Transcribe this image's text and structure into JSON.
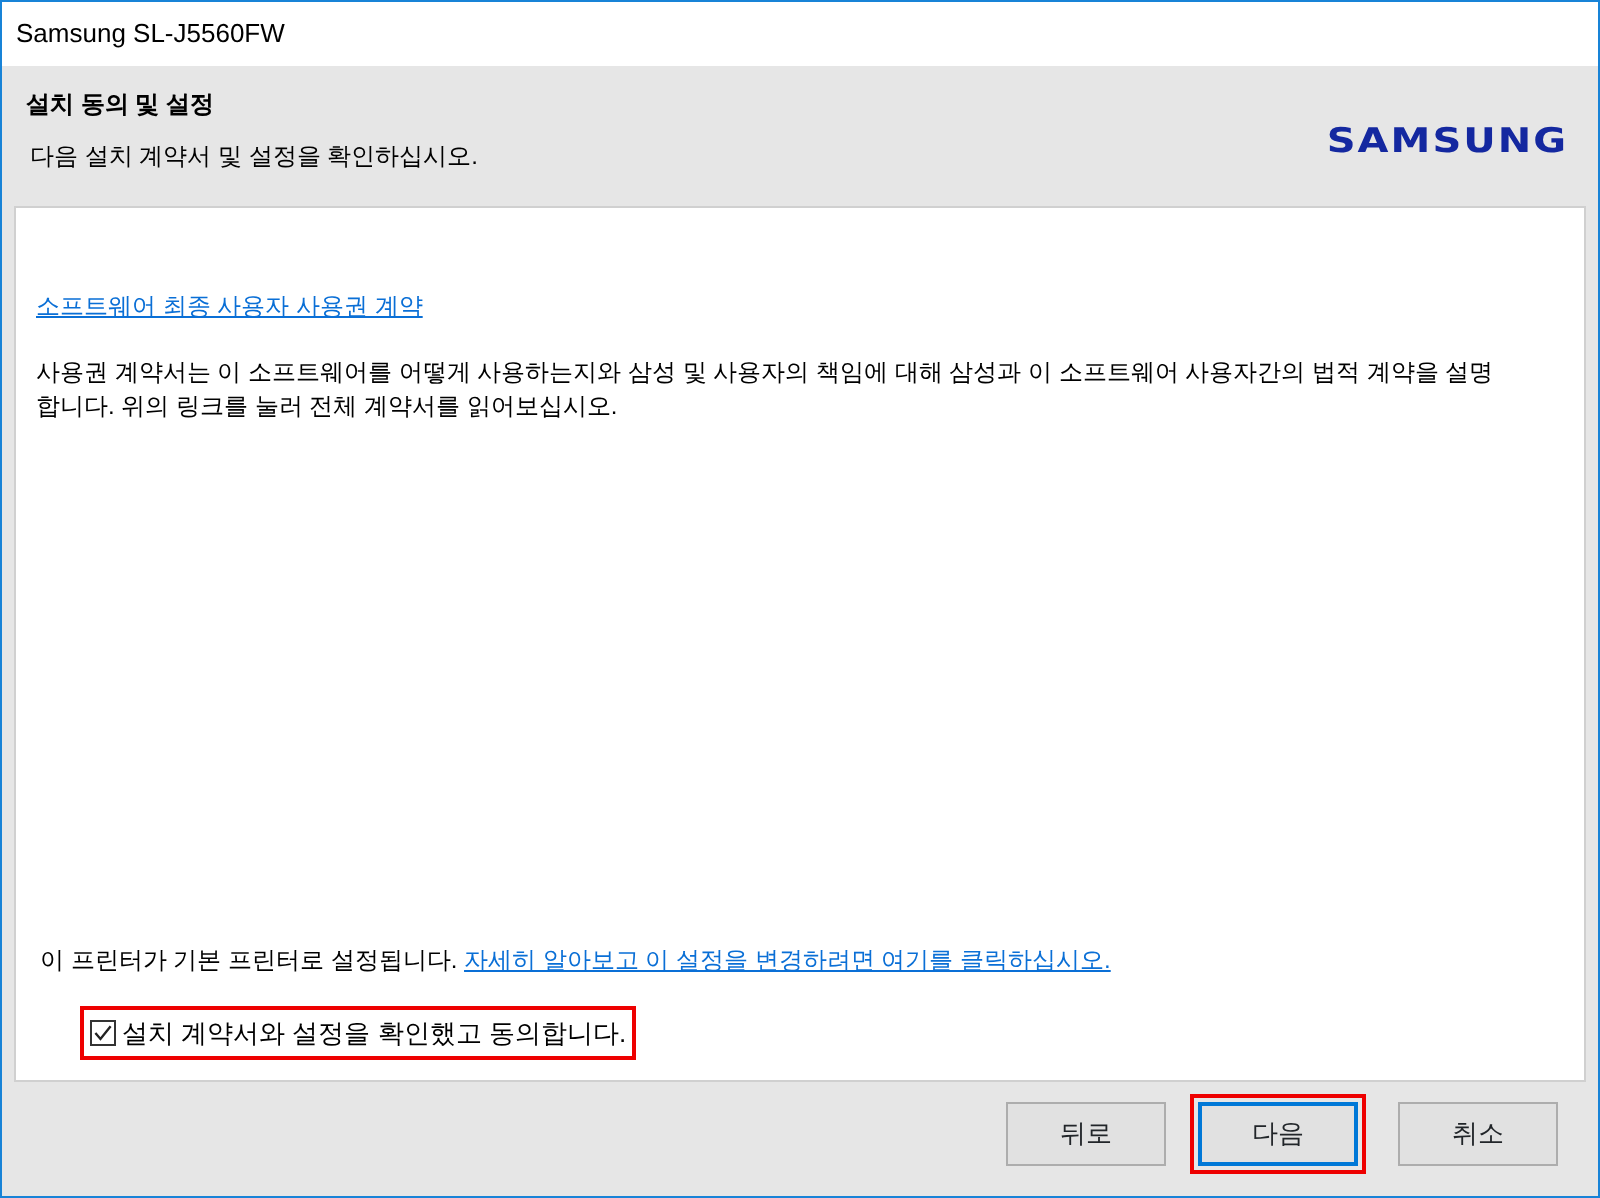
{
  "window": {
    "title": "Samsung SL-J5560FW"
  },
  "header": {
    "title": "설치 동의 및 설정",
    "subtitle": "다음 설치 계약서 및 설정을 확인하십시오.",
    "logo": "SAMSUNG"
  },
  "license_link": "소프트웨어 최종 사용자 사용권 계약",
  "description": "사용권 계약서는 이 소프트웨어를 어떻게 사용하는지와 삼성 및 사용자의 책임에 대해 삼성과 이 소프트웨어 사용자간의 법적 계약을 설명합니다. 위의 링크를 눌러 전체 계약서를 읽어보십시오.",
  "default_printer": {
    "text": "이 프린터가 기본 프린터로 설정됩니다.",
    "link": "자세히 알아보고 이 설정을 변경하려면 여기를 클릭하십시오."
  },
  "agree_checkbox": {
    "label": "설치 계약서와 설정을 확인했고 동의합니다.",
    "checked": true,
    "highlighted": true
  },
  "buttons": [
    {
      "label": "뒤로",
      "focused": false,
      "highlighted": false
    },
    {
      "label": "다음",
      "focused": true,
      "highlighted": true
    },
    {
      "label": "취소",
      "focused": false,
      "highlighted": false
    }
  ]
}
